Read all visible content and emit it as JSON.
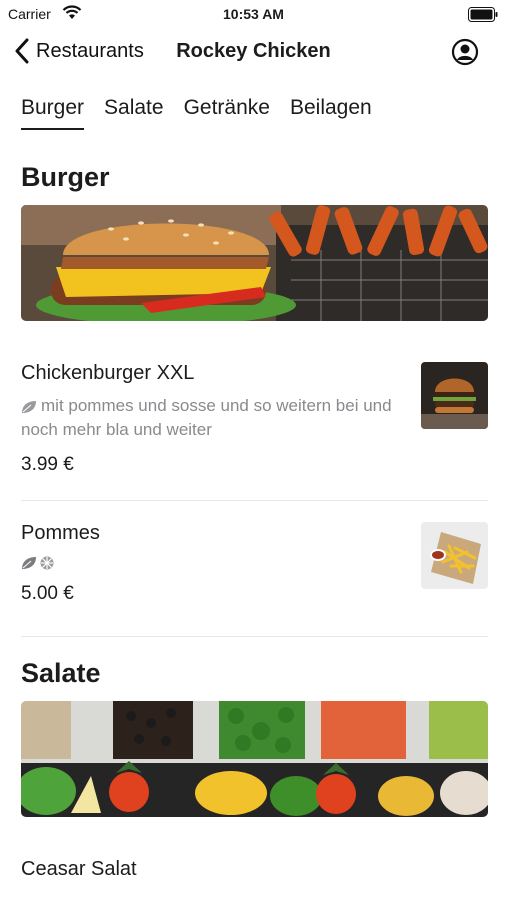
{
  "status_bar": {
    "carrier": "Carrier",
    "time": "10:53 AM"
  },
  "nav": {
    "back_label": "Restaurants",
    "title": "Rockey Chicken"
  },
  "tabs": [
    {
      "label": "Burger",
      "active": true
    },
    {
      "label": "Salate",
      "active": false
    },
    {
      "label": "Getränke",
      "active": false
    },
    {
      "label": "Beilagen",
      "active": false
    }
  ],
  "sections": [
    {
      "title": "Burger",
      "items": [
        {
          "name": "Chickenburger XXL",
          "description": "mit pommes und sosse und so weitern bei und noch mehr bla und weiter",
          "price": "3.99 €",
          "icons": [
            "leaf-icon"
          ]
        },
        {
          "name": "Pommes",
          "description": "",
          "price": "5.00 €",
          "icons": [
            "leaf-icon",
            "wheat-icon"
          ]
        }
      ]
    },
    {
      "title": "Salate",
      "items": [
        {
          "name": "Ceasar Salat"
        }
      ]
    }
  ],
  "colors": {
    "text": "#1c1c1e",
    "secondary_text": "#8a8a8e",
    "separator": "#e6e6e8"
  }
}
